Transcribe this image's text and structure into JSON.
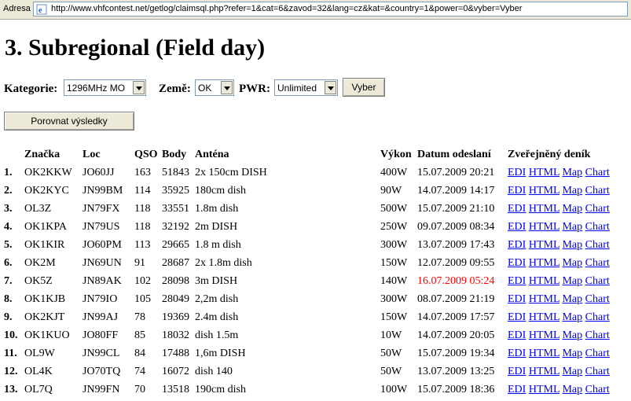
{
  "browser": {
    "address_label": "Adresa",
    "url": "http://www.vhfcontest.net/getlog/claimsql.php?refer=1&cat=6&zavod=32&lang=cz&kat=&country=1&power=0&vyber=Vyber"
  },
  "page": {
    "title": "3. Subregional (Field day)"
  },
  "filters": {
    "kategorie_label": "Kategorie:",
    "kategorie_value": "1296MHz MO",
    "zeme_label": "Země:",
    "zeme_value": "OK",
    "pwr_label": "PWR:",
    "pwr_value": "Unlimited",
    "vyber_button": "Vyber",
    "compare_button": "Porovnat výsledky"
  },
  "table": {
    "headers": {
      "znacka": "Značka",
      "loc": "Loc",
      "qso": "QSO",
      "body": "Body",
      "antena": "Anténa",
      "vykon": "Výkon",
      "datum": "Datum odeslaní",
      "denik": "Zveřejněný deník"
    },
    "link_labels": {
      "edi": "EDI",
      "html": "HTML",
      "map": "Map",
      "chart": "Chart"
    },
    "late_color": "#ff0000",
    "link_color": "#0000ee",
    "rows": [
      {
        "rank": "1.",
        "call": "OK2KKW",
        "loc": "JO60JJ",
        "qso": "163",
        "points": "51843",
        "antenna": "2x 150cm DISH",
        "power": "400W",
        "date": "15.07.2009 20:21",
        "late": false
      },
      {
        "rank": "2.",
        "call": "OK2KYC",
        "loc": "JN99BM",
        "qso": "114",
        "points": "35925",
        "antenna": "180cm dish",
        "power": "90W",
        "date": "14.07.2009 14:17",
        "late": false
      },
      {
        "rank": "3.",
        "call": "OL3Z",
        "loc": "JN79FX",
        "qso": "118",
        "points": "33551",
        "antenna": "1.8m dish",
        "power": "500W",
        "date": "15.07.2009 21:10",
        "late": false
      },
      {
        "rank": "4.",
        "call": "OK1KPA",
        "loc": "JN79US",
        "qso": "118",
        "points": "32192",
        "antenna": "2m DISH",
        "power": "250W",
        "date": "09.07.2009 08:34",
        "late": false
      },
      {
        "rank": "5.",
        "call": "OK1KIR",
        "loc": "JO60PM",
        "qso": "113",
        "points": "29665",
        "antenna": "1.8 m dish",
        "power": "300W",
        "date": "13.07.2009 17:43",
        "late": false
      },
      {
        "rank": "6.",
        "call": "OK2M",
        "loc": "JN69UN",
        "qso": "91",
        "points": "28687",
        "antenna": "2x 1.8m dish",
        "power": "150W",
        "date": "12.07.2009 09:55",
        "late": false
      },
      {
        "rank": "7.",
        "call": "OK5Z",
        "loc": "JN89AK",
        "qso": "102",
        "points": "28098",
        "antenna": "3m DISH",
        "power": "140W",
        "date": "16.07.2009 05:24",
        "late": true
      },
      {
        "rank": "8.",
        "call": "OK1KJB",
        "loc": "JN79IO",
        "qso": "105",
        "points": "28049",
        "antenna": "2,2m dish",
        "power": "300W",
        "date": "08.07.2009 21:19",
        "late": false
      },
      {
        "rank": "9.",
        "call": "OK2KJT",
        "loc": "JN99AJ",
        "qso": "78",
        "points": "19369",
        "antenna": "2.4m dish",
        "power": "150W",
        "date": "14.07.2009 17:57",
        "late": false
      },
      {
        "rank": "10.",
        "call": "OK1KUO",
        "loc": "JO80FF",
        "qso": "85",
        "points": "18032",
        "antenna": "dish 1.5m",
        "power": "10W",
        "date": "14.07.2009 20:05",
        "late": false
      },
      {
        "rank": "11.",
        "call": "OL9W",
        "loc": "JN99CL",
        "qso": "84",
        "points": "17488",
        "antenna": "1,6m DISH",
        "power": "50W",
        "date": "15.07.2009 19:34",
        "late": false
      },
      {
        "rank": "12.",
        "call": "OL4K",
        "loc": "JO70TQ",
        "qso": "74",
        "points": "16072",
        "antenna": "dish 140",
        "power": "50W",
        "date": "13.07.2009 13:25",
        "late": false
      },
      {
        "rank": "13.",
        "call": "OL7Q",
        "loc": "JN99FN",
        "qso": "70",
        "points": "13518",
        "antenna": "190cm dish",
        "power": "100W",
        "date": "15.07.2009 18:36",
        "late": false
      }
    ]
  }
}
